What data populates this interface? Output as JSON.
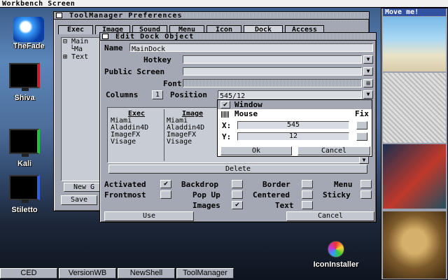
{
  "screen": {
    "title": "Workbench Screen"
  },
  "desktop_icons": [
    {
      "label": "TheFade"
    },
    {
      "label": "Shiva"
    },
    {
      "label": "Kali"
    },
    {
      "label": "Stiletto"
    },
    {
      "label": "IconInstaller"
    }
  ],
  "toolmanager": {
    "title": "ToolManager Preferences",
    "tabs": [
      "Exec",
      "Image",
      "Sound",
      "Menu",
      "Icon",
      "Dock",
      "Access"
    ],
    "tree": [
      "Main",
      "Ma",
      "Text"
    ],
    "new_button": "New G",
    "save_button": "Save"
  },
  "edit_dock": {
    "title": "Edit Dock Object",
    "name_label": "Name",
    "name_value": "MainDock",
    "hotkey_label": "Hotkey",
    "public_screen_label": "Public Screen",
    "font_label": "Font",
    "columns_label": "Columns",
    "columns_value": "1",
    "position_label": "Position",
    "position_value": "545/12",
    "list_headers": [
      "Exec",
      "Image"
    ],
    "exec_items": [
      "Miami",
      "Aladdin4D",
      "ImageFX",
      "Visage"
    ],
    "image_items": [
      "Miami",
      "Aladdin4D",
      "ImageFX",
      "Visage"
    ],
    "delete_button": "Delete",
    "options": [
      {
        "label": "Activated",
        "checked": true
      },
      {
        "label": "Backdrop",
        "checked": false
      },
      {
        "label": "Border",
        "checked": false
      },
      {
        "label": "Menu",
        "checked": false
      },
      {
        "label": "Frontmost",
        "checked": false
      },
      {
        "label": "Pop Up",
        "checked": false
      },
      {
        "label": "Centered",
        "checked": false
      },
      {
        "label": "Sticky",
        "checked": false
      },
      {
        "label": "Images",
        "checked": true
      },
      {
        "label": "Text",
        "checked": false
      }
    ],
    "use_button": "Use",
    "cancel_button": "Cancel"
  },
  "position_popup": {
    "window_label": "Window",
    "mouse_label": "Mouse",
    "fix_label": "Fix",
    "x_label": "X:",
    "x_value": "545",
    "y_label": "Y:",
    "y_value": "12",
    "ok_button": "Ok",
    "cancel_button": "Cancel"
  },
  "dock_panel": {
    "title": "Move me!"
  },
  "taskbar": [
    "CED",
    "VersionWB",
    "NewShell",
    "ToolManager"
  ]
}
